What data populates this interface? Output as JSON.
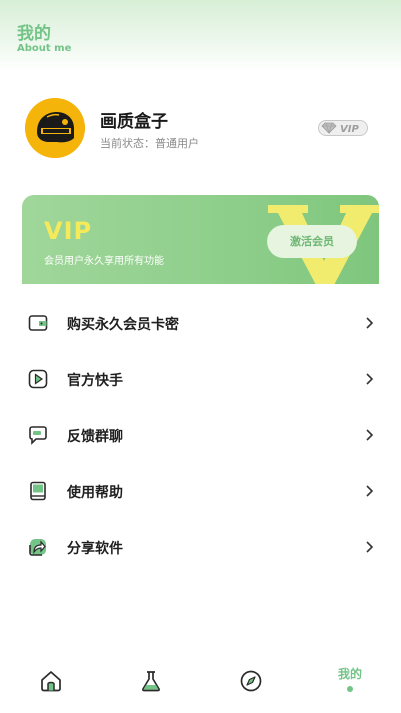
{
  "header": {
    "title": "我的",
    "subtitle": "About me"
  },
  "profile": {
    "name": "画质盒子",
    "status": "当前状态：普通用户",
    "badge": "VIP"
  },
  "vip_card": {
    "title": "VIP",
    "description": "会员用户永久享用所有功能",
    "button_label": "激活会员",
    "watermark": "V"
  },
  "menu": {
    "items": [
      {
        "label": "购买永久会员卡密",
        "icon": "wallet-icon"
      },
      {
        "label": "官方快手",
        "icon": "play-icon"
      },
      {
        "label": "反馈群聊",
        "icon": "chat-icon"
      },
      {
        "label": "使用帮助",
        "icon": "book-icon"
      },
      {
        "label": "分享软件",
        "icon": "share-icon"
      }
    ]
  },
  "tabbar": {
    "tabs": [
      {
        "icon": "home-icon"
      },
      {
        "icon": "flask-icon"
      },
      {
        "icon": "compass-icon"
      },
      {
        "label": "我的",
        "active": true
      }
    ]
  },
  "colors": {
    "accent": "#74c487",
    "vip_yellow": "#f4ea5a",
    "avatar_bg": "#f5b40a"
  }
}
